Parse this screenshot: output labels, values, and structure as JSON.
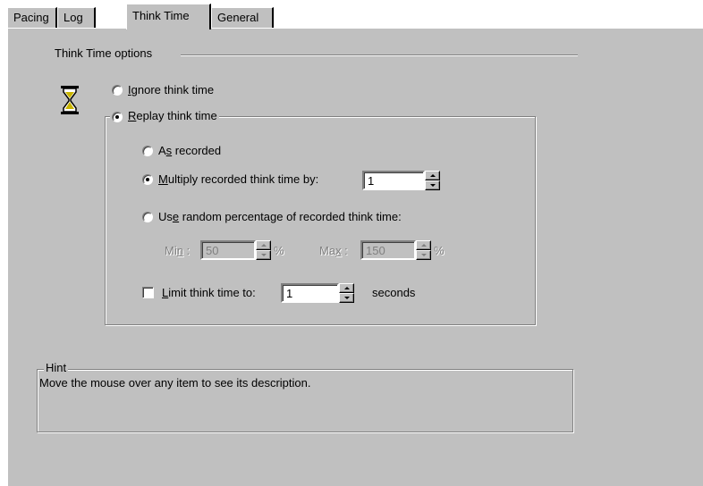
{
  "tabs": [
    {
      "label": "Pacing",
      "active": false
    },
    {
      "label": "Log",
      "active": false
    },
    {
      "label": "Think Time",
      "active": true
    },
    {
      "label": "General",
      "active": false
    }
  ],
  "options": {
    "group_title": "Think Time options",
    "ignore_label_pre": "",
    "ignore_label_u": "I",
    "ignore_label_post": "gnore think time",
    "replay_label_u": "R",
    "replay_label_post": "eplay think time",
    "as_recorded_pre": "A",
    "as_recorded_u": "s",
    "as_recorded_post": " recorded",
    "multiply_u": "M",
    "multiply_post": "ultiply recorded think time by:",
    "multiply_value": "1",
    "random_pre": "Us",
    "random_u": "e",
    "random_post": " random percentage of recorded think time:",
    "min_pre": "Mi",
    "min_u": "n",
    "min_post": " :",
    "min_value": "50",
    "min_unit": "%",
    "max_pre": "Ma",
    "max_u": "x",
    "max_post": " :",
    "max_value": "150",
    "max_unit": "%",
    "limit_u": "L",
    "limit_post": "imit think time to:",
    "limit_value": "1",
    "limit_unit": "seconds",
    "selected_mode": "replay",
    "selected_replay": "multiply",
    "limit_checked": false
  },
  "hint": {
    "title": "Hint",
    "text": "Move the mouse over any item to see its description."
  },
  "colors": {
    "face": "#c0c0c0",
    "shadow": "#808080",
    "highlight": "#ffffff",
    "hourglass_sand": "#c8b400"
  },
  "icons": {
    "hourglass": "hourglass-icon"
  }
}
